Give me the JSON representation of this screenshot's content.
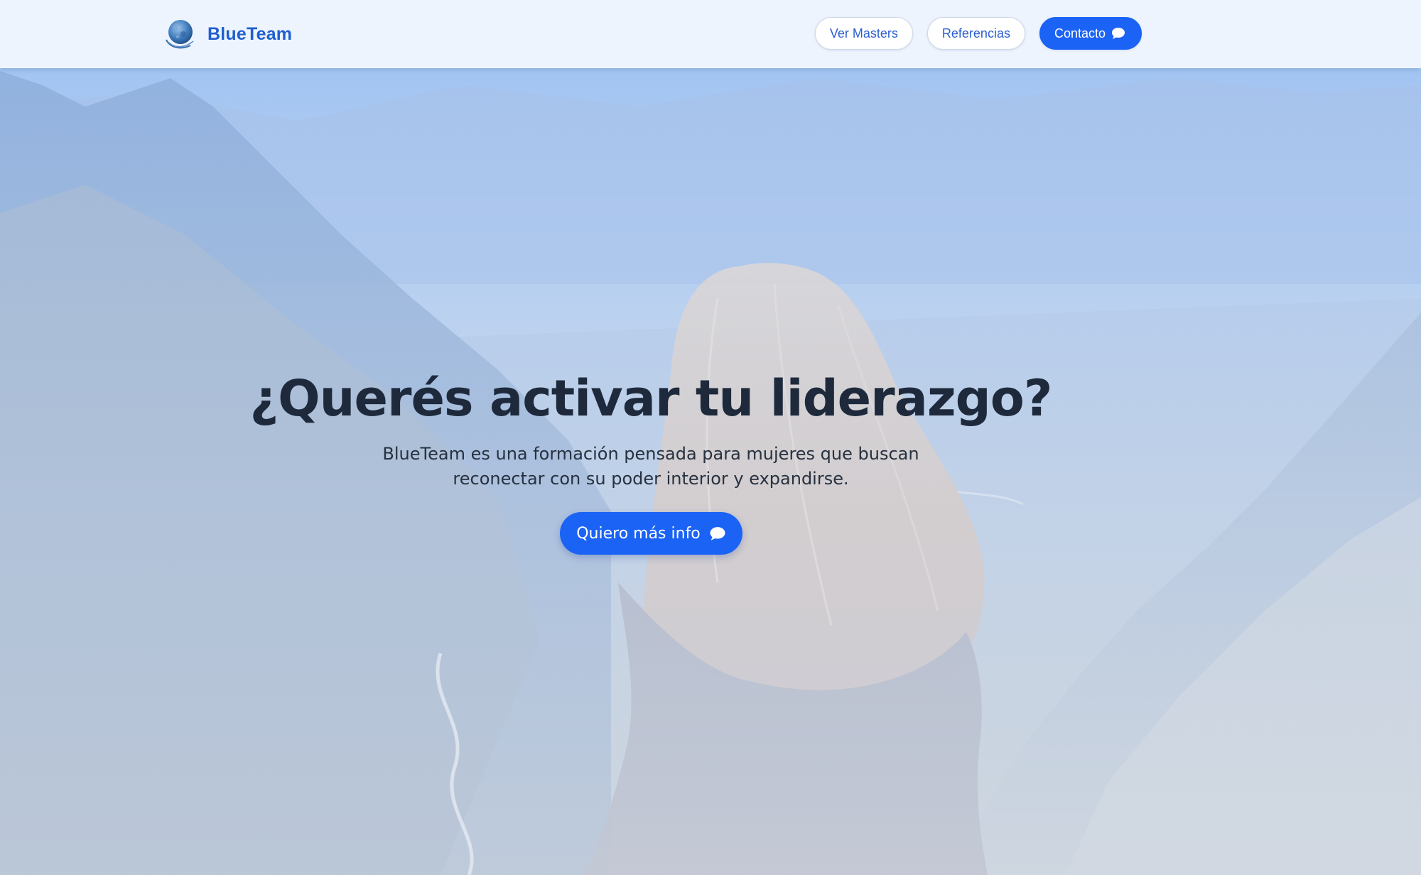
{
  "header": {
    "brand_name": "BlueTeam",
    "logo_icon": "moon-globe-logo-icon",
    "nav": [
      {
        "label": "Ver Masters",
        "style": "outline"
      },
      {
        "label": "Referencias",
        "style": "outline"
      },
      {
        "label": "Contacto",
        "style": "primary",
        "icon": "chat-bubble-icon"
      }
    ]
  },
  "hero": {
    "title": "¿Querés activar tu liderazgo?",
    "subtitle_line1": "BlueTeam es una formación pensada para mujeres que buscan",
    "subtitle_line2": "reconectar con su poder interior y expandirse.",
    "cta_label": "Quiero más info",
    "cta_icon": "chat-bubble-icon",
    "background_image": "woman-facing-mountain-valley"
  },
  "colors": {
    "brand": "#1f5fd0",
    "primary_button": "#1b63f5",
    "header_bg": "#eef4fd",
    "title_text": "#1e2a3c"
  }
}
